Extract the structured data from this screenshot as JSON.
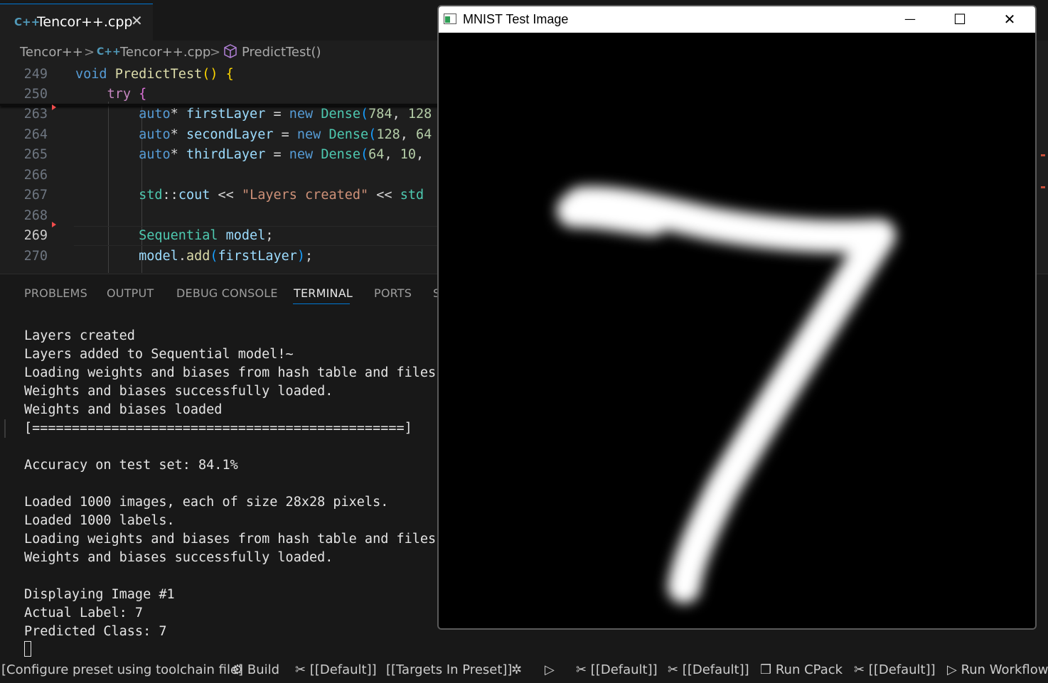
{
  "editor": {
    "tab": {
      "icon": "cpp-file-icon",
      "icon_text": "C++",
      "label": "Tencor++.cpp",
      "close": "✕"
    },
    "breadcrumb": {
      "folder": "Tencor++",
      "file_icon_text": "C++",
      "file": "Tencor++.cpp",
      "symbol_icon": "cube-icon",
      "symbol": "PredictTest()",
      "separator": ">"
    },
    "lines": [
      {
        "num": "249",
        "tokens": [
          [
            "kw",
            "void"
          ],
          [
            "op",
            " "
          ],
          [
            "fn",
            "PredictTest"
          ],
          [
            "br",
            "()"
          ],
          [
            "op",
            " "
          ],
          [
            "br",
            "{"
          ]
        ]
      },
      {
        "num": "250",
        "tokens": [
          [
            "op",
            "    "
          ],
          [
            "ctl",
            "try"
          ],
          [
            "op",
            " "
          ],
          [
            "br2",
            "{"
          ]
        ]
      },
      {
        "num": "263",
        "tokens": [
          [
            "op",
            "        "
          ],
          [
            "kw",
            "auto"
          ],
          [
            "op",
            "* "
          ],
          [
            "var",
            "firstLayer"
          ],
          [
            "op",
            " = "
          ],
          [
            "kw",
            "new"
          ],
          [
            "op",
            " "
          ],
          [
            "ty",
            "Dense"
          ],
          [
            "br3",
            "("
          ],
          [
            "num",
            "784"
          ],
          [
            "op",
            ", "
          ],
          [
            "num",
            "128"
          ]
        ]
      },
      {
        "num": "264",
        "tokens": [
          [
            "op",
            "        "
          ],
          [
            "kw",
            "auto"
          ],
          [
            "op",
            "* "
          ],
          [
            "var",
            "secondLayer"
          ],
          [
            "op",
            " = "
          ],
          [
            "kw",
            "new"
          ],
          [
            "op",
            " "
          ],
          [
            "ty",
            "Dense"
          ],
          [
            "br3",
            "("
          ],
          [
            "num",
            "128"
          ],
          [
            "op",
            ", "
          ],
          [
            "num",
            "64"
          ]
        ]
      },
      {
        "num": "265",
        "tokens": [
          [
            "op",
            "        "
          ],
          [
            "kw",
            "auto"
          ],
          [
            "op",
            "* "
          ],
          [
            "var",
            "thirdLayer"
          ],
          [
            "op",
            " = "
          ],
          [
            "kw",
            "new"
          ],
          [
            "op",
            " "
          ],
          [
            "ty",
            "Dense"
          ],
          [
            "br3",
            "("
          ],
          [
            "num",
            "64"
          ],
          [
            "op",
            ", "
          ],
          [
            "num",
            "10"
          ],
          [
            "op",
            ","
          ]
        ]
      },
      {
        "num": "266",
        "tokens": []
      },
      {
        "num": "267",
        "tokens": [
          [
            "op",
            "        "
          ],
          [
            "ty",
            "std"
          ],
          [
            "op",
            "::"
          ],
          [
            "var",
            "cout"
          ],
          [
            "op",
            " << "
          ],
          [
            "str",
            "\"Layers created\""
          ],
          [
            "op",
            " << "
          ],
          [
            "ty",
            "std"
          ]
        ]
      },
      {
        "num": "268",
        "tokens": []
      },
      {
        "num": "269",
        "tokens": [
          [
            "op",
            "        "
          ],
          [
            "ty",
            "Sequential"
          ],
          [
            "op",
            " "
          ],
          [
            "var",
            "model"
          ],
          [
            "op",
            ";"
          ]
        ]
      },
      {
        "num": "270",
        "tokens": [
          [
            "op",
            "        "
          ],
          [
            "var",
            "model"
          ],
          [
            "op",
            "."
          ],
          [
            "fn",
            "add"
          ],
          [
            "br3",
            "("
          ],
          [
            "var",
            "firstLayer"
          ],
          [
            "br3",
            ")"
          ],
          [
            "op",
            ";"
          ]
        ]
      }
    ],
    "current_line": "269"
  },
  "panel": {
    "tabs": [
      "PROBLEMS",
      "OUTPUT",
      "DEBUG CONSOLE",
      "TERMINAL",
      "PORTS",
      "S"
    ],
    "active_tab": "TERMINAL",
    "terminal_lines": [
      "Layers created",
      "Layers added to Sequential model!~",
      "Loading weights and biases from hash table and files.",
      "Weights and biases successfully loaded.",
      "Weights and biases loaded",
      "[===============================================]",
      "",
      "Accuracy on test set: 84.1%",
      "",
      "Loaded 1000 images, each of size 28x28 pixels.",
      "Loaded 1000 labels.",
      "Loading weights and biases from hash table and files.",
      "Weights and biases successfully loaded.",
      "",
      "Displaying Image #1",
      "Actual Label: 7",
      "Predicted Class: 7"
    ]
  },
  "statusbar": {
    "items": [
      {
        "name": "configure-preset",
        "icon": "",
        "label": "[Configure preset using toolchain file]"
      },
      {
        "name": "build",
        "icon": "⚙",
        "label": "Build"
      },
      {
        "name": "build-preset",
        "icon": "✂",
        "label": "[[Default]]"
      },
      {
        "name": "targets",
        "icon": "",
        "label": "[[Targets In Preset]]"
      },
      {
        "name": "debug",
        "icon": "✲",
        "label": ""
      },
      {
        "name": "run",
        "icon": "▷",
        "label": ""
      },
      {
        "name": "test-preset",
        "icon": "✂",
        "label": "[[Default]]"
      },
      {
        "name": "package-preset",
        "icon": "✂",
        "label": "[[Default]]"
      },
      {
        "name": "run-cpack",
        "icon": "❒",
        "label": "Run CPack"
      },
      {
        "name": "workflow-preset",
        "icon": "✂",
        "label": "[[Default]]"
      },
      {
        "name": "run-workflow",
        "icon": "▷",
        "label": "Run Workflow"
      }
    ]
  },
  "mnist_window": {
    "title": "MNIST Test Image",
    "minimize": "—",
    "maximize": "☐",
    "close": "✕",
    "digit_shown": "7"
  }
}
